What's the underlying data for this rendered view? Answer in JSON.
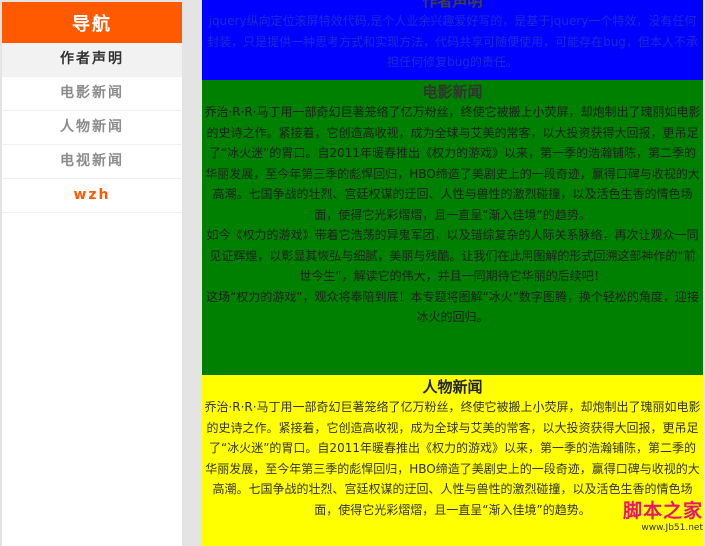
{
  "nav": {
    "title": "导航",
    "items": [
      {
        "label": "作者声明"
      },
      {
        "label": "电影新闻"
      },
      {
        "label": "人物新闻"
      },
      {
        "label": "电视新闻"
      },
      {
        "label": "wzh"
      }
    ]
  },
  "sections": {
    "author": {
      "title": "作者声明",
      "text": "jquery纵向定位滚屏特效代码,是个人业余兴趣爱好写的，是基于jquery一个特效，没有任何封装，只是提供一种思考方式和实现方法，代码共享可随便使用，可能存在bug，但本人不承担任何修复bug的责任。"
    },
    "film": {
      "title": "电影新闻",
      "paragraphs": [
        "乔治·R·R·马丁用一部奇幻巨著笼络了亿万粉丝，终使它被搬上小荧屏，却炮制出了瑰丽如电影的史诗之作。紧接着，它创造高收视，成为全球与艾美的常客，以大投资获得大回报，更吊足了“冰火迷”的胃口。自2011年暖春推出《权力的游戏》以来，第一季的浩瀚铺陈，第二季的华丽发展，至今年第三季的彪悍回归，HBO缔造了美剧史上的一段奇迹，赢得口碑与收视的大高潮。七国争战的壮烈、宫廷权谋的迂回、人性与兽性的激烈碰撞，以及活色生香的情色场面，使得它光彩熠熠，且一直呈“渐入佳境”的趋势。",
        "如今《权力的游戏》带着它浩荡的异鬼军团，以及错综复杂的人际关系脉络，再次让观众一同见证辉煌，以彰显其恢弘与细腻，美丽与残酷。让我们在此用图解的形式回溯这部神作的“前世今生”，解读它的伟大，并且一同期待它华丽的后续吧！",
        "这场“权力的游戏”，观众将奉陪到底！本专题将图解“冰火”数字图腾，换个轻松的角度，迎接冰火的回归。"
      ]
    },
    "people": {
      "title": "人物新闻",
      "text": "乔治·R·R·马丁用一部奇幻巨著笼络了亿万粉丝，终使它被搬上小荧屏，却炮制出了瑰丽如电影的史诗之作。紧接着，它创造高收视，成为全球与艾美的常客，以大投资获得大回报，更吊足了“冰火迷”的胃口。自2011年暖春推出《权力的游戏》以来，第一季的浩瀚铺陈，第二季的华丽发展，至今年第三季的彪悍回归，HBO缔造了美剧史上的一段奇迹，赢得口碑与收视的大高潮。七国争战的壮烈、宫廷权谋的迂回、人性与兽性的激烈碰撞，以及活色生香的情色场面，使得它光彩熠熠，且一直呈“渐入佳境”的趋势。"
    }
  },
  "watermark": {
    "title": "脚本之家",
    "url": "www.Jb51.net"
  },
  "colors": {
    "nav_header": "#ff5a00",
    "author_bg": "#0000ff",
    "film_bg": "#008000",
    "people_bg": "#ffff00"
  }
}
